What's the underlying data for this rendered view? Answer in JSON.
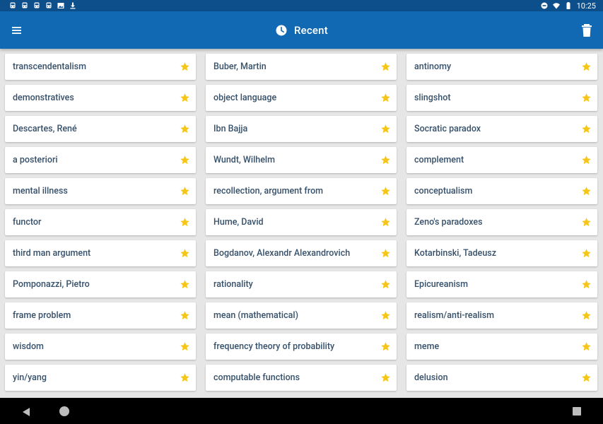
{
  "status_bar": {
    "time": "10:25",
    "left_icons": [
      "train-icon",
      "train-icon",
      "train-icon",
      "train-icon",
      "image-icon",
      "download-icon"
    ],
    "right_icons": [
      "do-not-disturb-icon",
      "wifi-icon",
      "battery-icon"
    ]
  },
  "app_bar": {
    "title": "Recent",
    "title_icon": "clock-icon",
    "menu_icon": "hamburger-menu-icon",
    "action_icon": "trash-icon"
  },
  "colors": {
    "status_bar": "#0d4f8b",
    "app_bar": "#1168b3",
    "background": "#e6e6e6",
    "card": "#ffffff",
    "label_text": "#37516b",
    "star": "#f5c518",
    "nav_bar": "#000000"
  },
  "columns": [
    {
      "items": [
        "transcendentalism",
        "demonstratives",
        "Descartes, René",
        "a posteriori",
        "mental illness",
        "functor",
        "third man argument",
        "Pomponazzi, Pietro",
        "frame problem",
        "wisdom",
        "yin/yang"
      ]
    },
    {
      "items": [
        "Buber, Martin",
        "object language",
        "Ibn Bajja",
        "Wundt, Wilhelm",
        "recollection, argument from",
        "Hume, David",
        "Bogdanov, Alexandr Alexandrovich",
        "rationality",
        "mean (mathematical)",
        "frequency theory of probability",
        "computable functions"
      ]
    },
    {
      "items": [
        "antinomy",
        "slingshot",
        "Socratic paradox",
        "complement",
        "conceptualism",
        "Zeno's paradoxes",
        "Kotarbinski, Tadeusz",
        "Epicureanism",
        "realism/anti-realism",
        "meme",
        "delusion"
      ]
    }
  ],
  "nav_bar": {
    "buttons": [
      "back-icon",
      "home-icon",
      "recent-apps-icon"
    ]
  }
}
